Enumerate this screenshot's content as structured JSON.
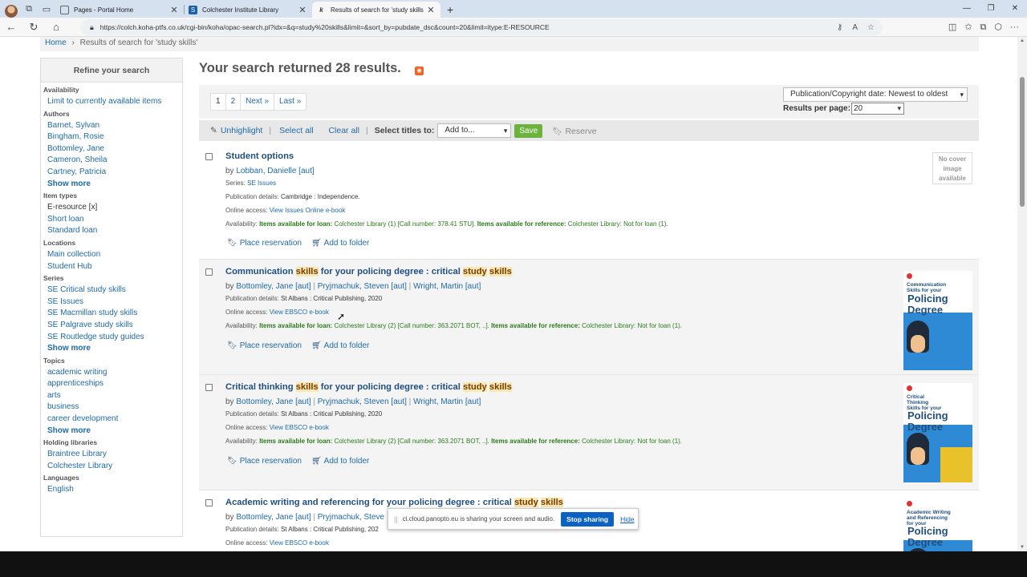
{
  "browser": {
    "tabs": [
      {
        "title": "Pages - Portal Home",
        "active": false
      },
      {
        "title": "Colchester Institute Library",
        "active": false
      },
      {
        "title": "Results of search for 'study skills",
        "active": true
      }
    ],
    "url": "https://colch.koha-ptfs.co.uk/cgi-bin/koha/opac-search.pl?idx=&q=study%20skills&limit=&sort_by=pubdate_dsc&count=20&limit=itype:E-RESOURCE"
  },
  "breadcrumb": {
    "home": "Home",
    "sep": "›",
    "current": "Results of search for 'study skills'"
  },
  "sidebar": {
    "title": "Refine your search",
    "sections": [
      {
        "heading": "Availability",
        "items": [
          {
            "label": "Limit to currently available items"
          }
        ]
      },
      {
        "heading": "Authors",
        "items": [
          {
            "label": "Barnet, Sylvan"
          },
          {
            "label": "Bingham, Rosie"
          },
          {
            "label": "Bottomley, Jane"
          },
          {
            "label": "Cameron, Sheila"
          },
          {
            "label": "Cartney, Patricia"
          },
          {
            "label": "Show more",
            "more": true
          }
        ]
      },
      {
        "heading": "Item types",
        "items": [
          {
            "label": "E-resource [x]",
            "selected": true
          },
          {
            "label": "Short loan"
          },
          {
            "label": "Standard loan"
          }
        ]
      },
      {
        "heading": "Locations",
        "items": [
          {
            "label": "Main collection"
          },
          {
            "label": "Student Hub"
          }
        ]
      },
      {
        "heading": "Series",
        "items": [
          {
            "label": "SE Critical study skills"
          },
          {
            "label": "SE Issues"
          },
          {
            "label": "SE Macmillan study skills"
          },
          {
            "label": "SE Palgrave study skills"
          },
          {
            "label": "SE Routledge study guides"
          },
          {
            "label": "Show more",
            "more": true
          }
        ]
      },
      {
        "heading": "Topics",
        "items": [
          {
            "label": "academic writing"
          },
          {
            "label": "apprenticeships"
          },
          {
            "label": "arts"
          },
          {
            "label": "business"
          },
          {
            "label": "career development"
          },
          {
            "label": "Show more",
            "more": true
          }
        ]
      },
      {
        "heading": "Holding libraries",
        "items": [
          {
            "label": "Braintree Library"
          },
          {
            "label": "Colchester Library"
          }
        ]
      },
      {
        "heading": "Languages",
        "items": [
          {
            "label": "English"
          }
        ]
      }
    ]
  },
  "results_header": "Your search returned 28 results.",
  "pager": {
    "p1": "1",
    "p2": "2",
    "next": "Next »",
    "last": "Last »"
  },
  "sort": {
    "selected": "Publication/Copyright date: Newest to oldest",
    "rpp_label": "Results per page:",
    "rpp_value": "20"
  },
  "toolbar": {
    "unhighlight": "Unhighlight",
    "select_all": "Select all",
    "clear_all": "Clear all",
    "select_titles": "Select titles to:",
    "add_to": "Add to...",
    "save": "Save",
    "reserve": "Reserve"
  },
  "results": [
    {
      "title_parts": [
        {
          "t": "Student options",
          "hl": false
        }
      ],
      "by": "by",
      "authors": [
        "Lobban, Danielle [aut]"
      ],
      "series_label": "Series:",
      "series": "SE Issues",
      "pub_label": "Publication details:",
      "pub": "Cambridge : Independence.",
      "online_label": "Online access:",
      "online": "View Issues Online e-book",
      "avail_label": "Availability:",
      "loan_label": "Items available for loan:",
      "loan": "Colchester Library (1) [Call number: 378.41 STU].",
      "ref_label": "Items available for reference:",
      "ref": "Colchester Library: Not for loan (1).",
      "cover": "No cover image available",
      "place_reservation": "Place reservation",
      "add_to_folder": "Add to folder"
    },
    {
      "title_parts": [
        {
          "t": "Communication ",
          "hl": false
        },
        {
          "t": "skills",
          "hl": true
        },
        {
          "t": " for your policing degree : critical ",
          "hl": false
        },
        {
          "t": "study",
          "hl": true
        },
        {
          "t": " ",
          "hl": false
        },
        {
          "t": "skills",
          "hl": true
        }
      ],
      "by": "by",
      "authors": [
        "Bottomley, Jane [aut]",
        "Pryjmachuk, Steven [aut]",
        "Wright, Martin [aut]"
      ],
      "pub_label": "Publication details:",
      "pub": "St Albans : Critical Publishing, 2020",
      "online_label": "Online access:",
      "online": "View EBSCO e-book",
      "avail_label": "Availability:",
      "loan_label": "Items available for loan:",
      "loan": "Colchester Library (2) [Call number: 363.2071 BOT, ..].",
      "ref_label": "Items available for reference:",
      "ref": "Colchester Library: Not for loan (1).",
      "cover_title": "Communication Skills for your",
      "cover_big": "Policing Degree",
      "place_reservation": "Place reservation",
      "add_to_folder": "Add to folder"
    },
    {
      "title_parts": [
        {
          "t": "Critical thinking ",
          "hl": false
        },
        {
          "t": "skills",
          "hl": true
        },
        {
          "t": " for your policing degree : critical ",
          "hl": false
        },
        {
          "t": "study",
          "hl": true
        },
        {
          "t": " ",
          "hl": false
        },
        {
          "t": "skills",
          "hl": true
        }
      ],
      "by": "by",
      "authors": [
        "Bottomley, Jane [aut]",
        "Pryjmachuk, Steven [aut]",
        "Wright, Martin [aut]"
      ],
      "pub_label": "Publication details:",
      "pub": "St Albans : Critical Publishing, 2020",
      "online_label": "Online access:",
      "online": "View EBSCO e-book",
      "avail_label": "Availability:",
      "loan_label": "Items available for loan:",
      "loan": "Colchester Library (2) [Call number: 363.2071 BOT, ..].",
      "ref_label": "Items available for reference:",
      "ref": "Colchester Library: Not for loan (1).",
      "cover_title": "Critical Thinking Skills for your",
      "cover_big": "Policing Degree",
      "place_reservation": "Place reservation",
      "add_to_folder": "Add to folder"
    },
    {
      "title_parts": [
        {
          "t": "Academic writing and referencing for your policing degree : critical ",
          "hl": false
        },
        {
          "t": "study",
          "hl": true
        },
        {
          "t": " ",
          "hl": false
        },
        {
          "t": "skills",
          "hl": true
        }
      ],
      "by": "by",
      "authors": [
        "Bottomley, Jane [aut]",
        "Pryjmachuk, Steve"
      ],
      "pub_label": "Publication details:",
      "pub": "St Albans : Critical Publishing, 202",
      "online_label": "Online access:",
      "online": "View EBSCO e-book",
      "cover_title": "Academic Writing and Referencing for your",
      "cover_big": "Policing Degree"
    }
  ],
  "share_bar": {
    "grip": "||",
    "text": "ci.cloud.panopto.eu is sharing your screen and audio.",
    "stop": "Stop sharing",
    "hide": "Hide"
  }
}
